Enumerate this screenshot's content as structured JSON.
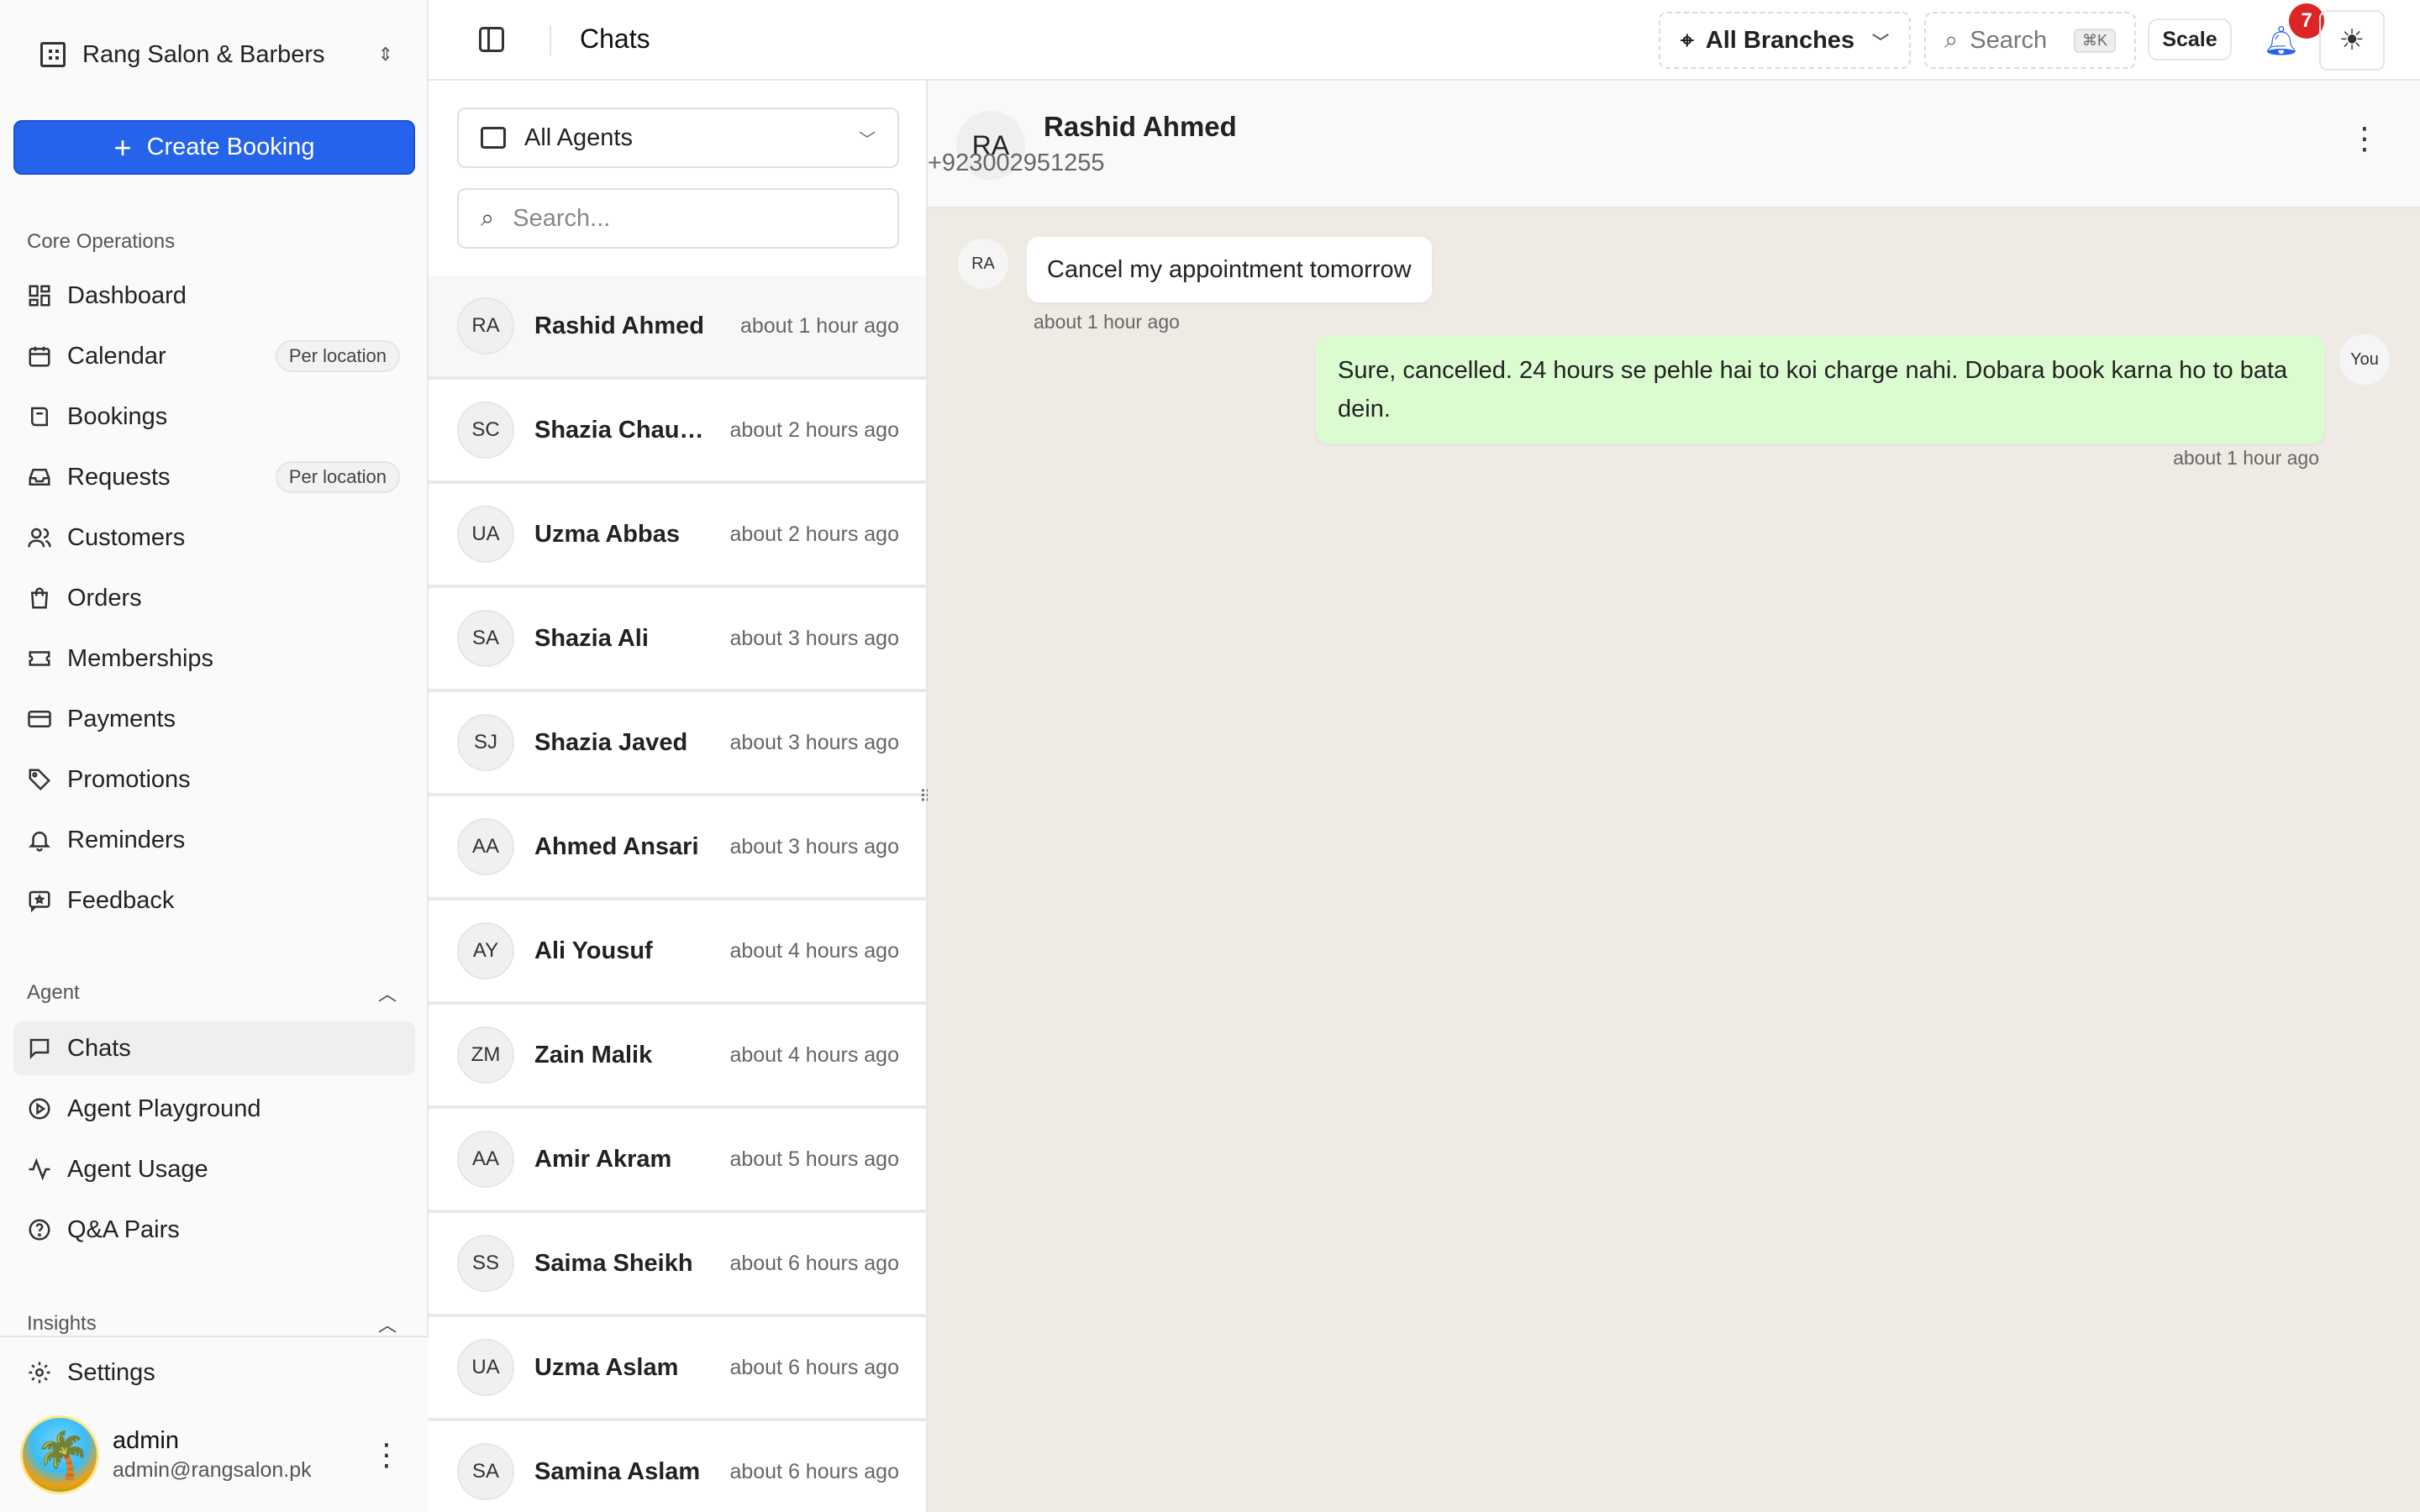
{
  "org": {
    "name": "Rang Salon & Barbers"
  },
  "sidebar": {
    "create_label": "Create Booking",
    "core_label": "Core Operations",
    "core_items": [
      {
        "label": "Dashboard",
        "badge": ""
      },
      {
        "label": "Calendar",
        "badge": "Per location"
      },
      {
        "label": "Bookings",
        "badge": ""
      },
      {
        "label": "Requests",
        "badge": "Per location"
      },
      {
        "label": "Customers",
        "badge": ""
      },
      {
        "label": "Orders",
        "badge": ""
      },
      {
        "label": "Memberships",
        "badge": ""
      },
      {
        "label": "Payments",
        "badge": ""
      },
      {
        "label": "Promotions",
        "badge": ""
      },
      {
        "label": "Reminders",
        "badge": ""
      },
      {
        "label": "Feedback",
        "badge": ""
      }
    ],
    "agent_label": "Agent",
    "agent_items": [
      {
        "label": "Chats"
      },
      {
        "label": "Agent Playground"
      },
      {
        "label": "Agent Usage"
      },
      {
        "label": "Q&A Pairs"
      }
    ],
    "insights_label": "Insights",
    "settings_label": "Settings",
    "user": {
      "name": "admin",
      "email": "admin@rangsalon.pk"
    }
  },
  "topbar": {
    "title": "Chats",
    "branches": "All Branches",
    "search": "Search",
    "shortcut": "⌘K",
    "scale": "Scale",
    "notifications": "7"
  },
  "chatlist": {
    "agent_filter": "All Agents",
    "search_placeholder": "Search...",
    "rows": [
      {
        "initials": "RA",
        "name": "Rashid Ahmed",
        "time": "about 1 hour ago"
      },
      {
        "initials": "SC",
        "name": "Shazia Chaud...",
        "time": "about 2 hours ago"
      },
      {
        "initials": "UA",
        "name": "Uzma Abbas",
        "time": "about 2 hours ago"
      },
      {
        "initials": "SA",
        "name": "Shazia Ali",
        "time": "about 3 hours ago"
      },
      {
        "initials": "SJ",
        "name": "Shazia Javed",
        "time": "about 3 hours ago"
      },
      {
        "initials": "AA",
        "name": "Ahmed Ansari",
        "time": "about 3 hours ago"
      },
      {
        "initials": "AY",
        "name": "Ali Yousuf",
        "time": "about 4 hours ago"
      },
      {
        "initials": "ZM",
        "name": "Zain Malik",
        "time": "about 4 hours ago"
      },
      {
        "initials": "AA",
        "name": "Amir Akram",
        "time": "about 5 hours ago"
      },
      {
        "initials": "SS",
        "name": "Saima Sheikh",
        "time": "about 6 hours ago"
      },
      {
        "initials": "UA",
        "name": "Uzma Aslam",
        "time": "about 6 hours ago"
      },
      {
        "initials": "SA",
        "name": "Samina Aslam",
        "time": "about 6 hours ago"
      }
    ]
  },
  "conversation": {
    "initials": "RA",
    "name": "Rashid Ahmed",
    "phone": "+923002951255",
    "incoming": {
      "initials": "RA",
      "text": "Cancel my appointment tomorrow",
      "time": "about 1 hour ago"
    },
    "outgoing": {
      "avatar": "You",
      "text": "Sure, cancelled. 24 hours se pehle hai to koi charge nahi. Dobara book karna ho to bata dein.",
      "time": "about 1 hour ago"
    }
  },
  "colors": {
    "accent": "#2563eb",
    "badge": "#dc2626",
    "outgoing_bubble": "#dbfcd0",
    "chat_bg": "#efebe4"
  }
}
